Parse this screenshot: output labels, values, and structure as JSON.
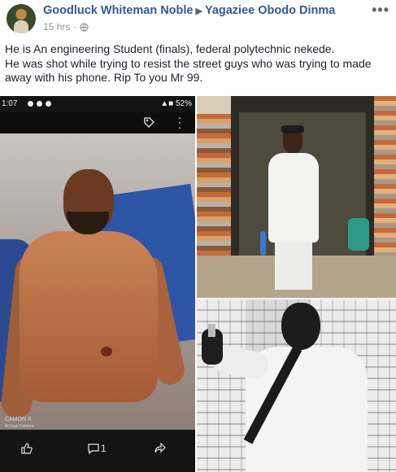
{
  "post": {
    "author": "Goodluck Whiteman Noble",
    "target": "Yagaziee Obodo Dinma",
    "time": "15 hrs",
    "separator": "·",
    "more_label": "•••",
    "text_lines": [
      "He is An engineering Student (finals), federal polytechnic nekede.",
      "He was shot while trying to resist the street guys who was trying to made away with his phone. Rip To you Mr 99."
    ]
  },
  "phone_screenshot": {
    "time": "1:07",
    "battery": "52%",
    "watermark_line1": "CAMON X",
    "watermark_line2": "AI Dual Camera",
    "comment_count": "1"
  },
  "icons": {
    "globe": "globe-icon",
    "caret": "caret-right-icon",
    "tag": "tag-icon",
    "kebab": "kebab-menu-icon",
    "like": "thumbs-up-icon",
    "comment": "comment-icon",
    "share": "share-icon"
  },
  "colors": {
    "link": "#365899",
    "meta": "#90949c",
    "text": "#1d2129"
  }
}
